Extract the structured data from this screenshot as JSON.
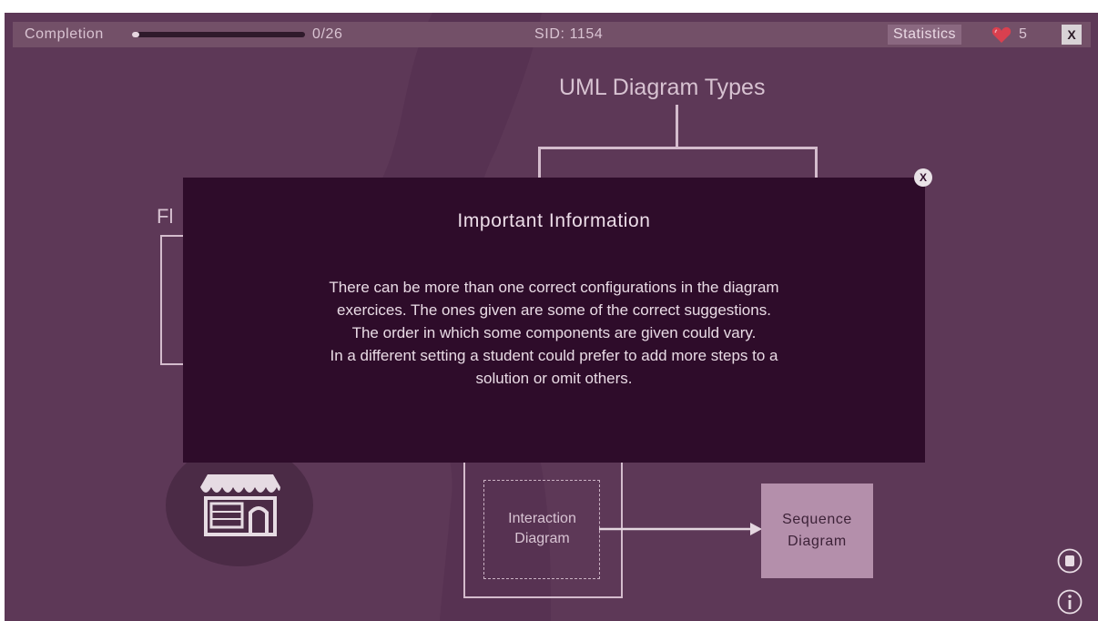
{
  "topbar": {
    "completion_label": "Completion",
    "progress_fraction": 0.04,
    "progress_text": "0/26",
    "sid_label": "SID:",
    "sid_value": "1154",
    "statistics_button": "Statistics",
    "lives_icon": "heart-icon",
    "lives_count": "5",
    "close_label": "X"
  },
  "background": {
    "uml_title": "UML Diagram Types",
    "flow_label_partial": "Fl",
    "interaction_node": "Interaction\nDiagram",
    "sequence_node": "Sequence\nDiagram",
    "store_icon": "store-icon",
    "side_icons": [
      "scroll-icon",
      "info-icon"
    ]
  },
  "modal": {
    "title": "Important Information",
    "lines": [
      "There can be more than one correct configurations in the diagram",
      "exercices. The ones given are some of the correct suggestions.",
      "The order in which some components are given could vary.",
      "In a different setting a student could prefer to add more steps to a",
      "solution or omit others."
    ],
    "close_label": "X"
  },
  "colors": {
    "background": "#5d3857",
    "topbar": "#735068",
    "modal": "#2e0c2a",
    "sequence_box": "#b48fab",
    "heart": "#d9404f"
  }
}
